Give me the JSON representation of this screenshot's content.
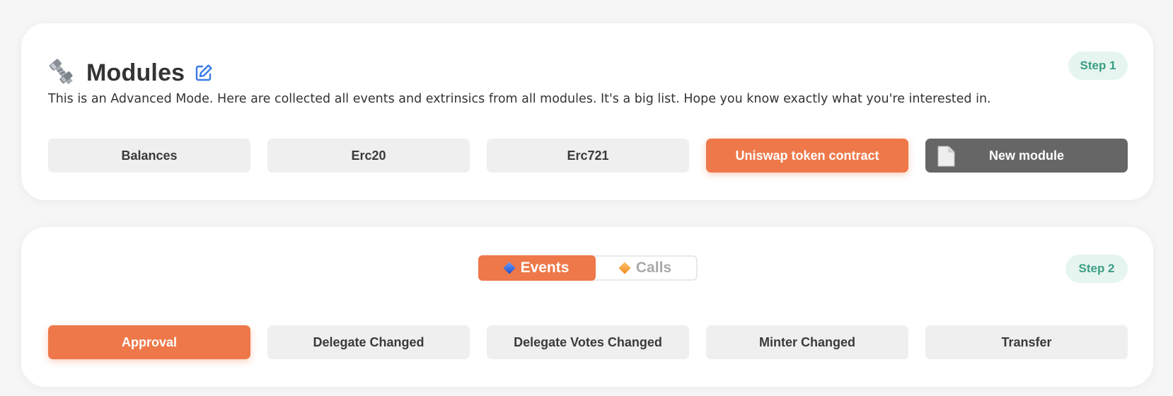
{
  "modules_card": {
    "title": "Modules",
    "description": "This is an Advanced Mode. Here are collected all events and extrinsics from all modules. It's a big list. Hope you know exactly what you're interested in.",
    "step": "Step 1",
    "modules": [
      {
        "label": "Balances",
        "active": false
      },
      {
        "label": "Erc20",
        "active": false
      },
      {
        "label": "Erc721",
        "active": false
      },
      {
        "label": "Uniswap token contract",
        "active": true
      },
      {
        "label": "New module",
        "active": false
      }
    ]
  },
  "events_card": {
    "step": "Step 2",
    "toggle": {
      "events_label": "Events",
      "calls_label": "Calls",
      "selected": "Events"
    },
    "items": [
      {
        "label": "Approval",
        "active": true
      },
      {
        "label": "Delegate Changed",
        "active": false
      },
      {
        "label": "Delegate Votes Changed",
        "active": false
      },
      {
        "label": "Minter Changed",
        "active": false
      },
      {
        "label": "Transfer",
        "active": false
      }
    ]
  },
  "colors": {
    "accent": "#ee7849",
    "step_bg": "#e6f5f0",
    "step_text": "#3a9e85",
    "button_bg": "#efefef",
    "dark_button": "#666666"
  },
  "icons": [
    "bolt-icon",
    "edit-icon",
    "file-icon",
    "blue-diamond-icon",
    "orange-diamond-icon"
  ]
}
